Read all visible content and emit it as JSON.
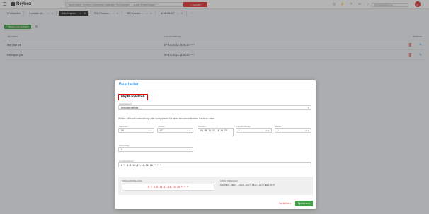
{
  "app": {
    "name": "Reybex"
  },
  "topbar": {
    "search_placeholder": "Nach Artikel, Kunden, Lieferanten, Aufträge, Rechnungen, ... suche Einstellungen",
    "search_button": "Suchen",
    "user_placeholder": "Tags Reebwimmung",
    "avatar_initial": "A"
  },
  "tabs": [
    {
      "label": "Prüftabellen"
    },
    {
      "label": "Kontakte (in..."
    },
    {
      "label": "Job-Einricht..."
    },
    {
      "label": "EDI-Protoko..."
    },
    {
      "label": "EDI Kunden ..."
    },
    {
      "label": "dt-MUSHOF"
    }
  ],
  "toolbar": {
    "add_label": "Neuen Job Anlegen"
  },
  "table": {
    "headers": {
      "name": "Job Name",
      "cron": "cron Einstellung",
      "actions": "Aktionen"
    },
    "rows": [
      {
        "name": "Mrp plan job",
        "cron": "0 * 4,8,10,12,14,16,20 * * *"
      },
      {
        "name": "Edi Import job",
        "cron": "0 * 4,8,10,12,14,16,20 * * *"
      }
    ]
  },
  "modal": {
    "title": "Bearbeiten",
    "job_name": "MrpPlanAllJob",
    "voreinstellung_label": "Voreinstellung*",
    "voreinstellung_value": "Benutzerdefiniert",
    "help_text": "Wählen Sie eine Voreinstellung oder konfigurieren Sie einen benutzerdefinierten Ausdruck unten",
    "sekunden_label": "Sekunden",
    "sekunden_value": "00",
    "minuten_label": "Minuten",
    "minuten_value": "07",
    "stunden_label": "Stunden",
    "stunden_value": "04, 08, 10, 12, 14, 16, 20",
    "tag_label": "Tag des Monats",
    "tag_value": "*",
    "monat_label": "Monat",
    "monat_value": "*",
    "wochentag_label": "Wochentag",
    "wochentag_value": "*",
    "cron_label": "cron Einstellung*",
    "cron_value": "0 7 4,8,10,12,14,16,20 * * *",
    "preview_cron_title": "CRON-EINSTELLUNG",
    "preview_cron_value": "0 7 4,8,10,12,14,16,20 * * *",
    "preview_title": "CRON VORSCHAU",
    "preview_text": "Um 04:07, 08:07, 10:07, 12:07, 14:07, 16:07 and 20:07",
    "close_label": "Schließen",
    "save_label": "Speichern"
  }
}
